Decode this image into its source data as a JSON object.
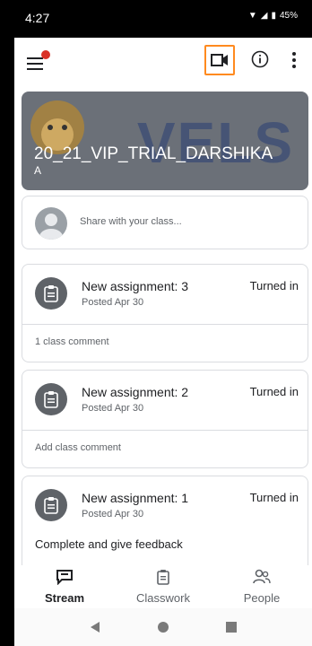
{
  "status": {
    "time": "4:27",
    "battery": "45%"
  },
  "class": {
    "title": "20_21_VIP_TRIAL_DARSHIKA",
    "section": "A",
    "banner_brand": "VELS"
  },
  "share": {
    "placeholder": "Share with your class..."
  },
  "posts": [
    {
      "title": "New assignment: 3",
      "date": "Posted Apr 30",
      "status": "Turned in",
      "footer": "1 class comment"
    },
    {
      "title": "New assignment: 2",
      "date": "Posted Apr 30",
      "status": "Turned in",
      "footer": "Add class comment"
    },
    {
      "title": "New assignment: 1",
      "date": "Posted Apr 30",
      "status": "Turned in",
      "footer": "Complete and give feedback"
    }
  ],
  "nav": {
    "stream": "Stream",
    "classwork": "Classwork",
    "people": "People"
  },
  "colors": {
    "accent_outline": "#ff8a1f",
    "notification_dot": "#d93025",
    "icon_gray": "#5f6368"
  }
}
